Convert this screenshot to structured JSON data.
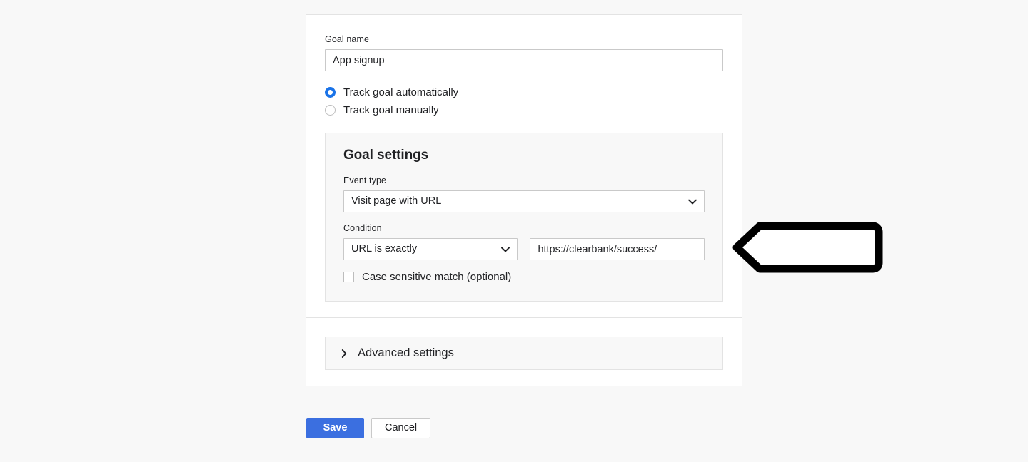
{
  "form": {
    "goal_name": {
      "label": "Goal name",
      "value": "App signup",
      "placeholder": "Goal name"
    },
    "tracking_mode": {
      "options": [
        {
          "label": "Track goal automatically",
          "selected": true
        },
        {
          "label": "Track goal manually",
          "selected": false
        }
      ]
    },
    "goal_settings": {
      "title": "Goal settings",
      "event_type": {
        "label": "Event type",
        "value": "Visit page with URL",
        "chevron_icon": "chevron-down-icon"
      },
      "condition": {
        "label": "Condition",
        "value": "URL is exactly",
        "chevron_icon": "chevron-down-icon",
        "url_value": "https://clearbank/success/",
        "url_placeholder": "https://example.com/"
      },
      "case_sensitive": {
        "label": "Case sensitive match (optional)",
        "checked": false
      }
    },
    "advanced": {
      "label": "Advanced settings",
      "chevron_icon": "chevron-right-icon",
      "expanded": false
    }
  },
  "footer": {
    "save_label": "Save",
    "cancel_label": "Cancel"
  },
  "annotation": {
    "arrow_icon": "left-arrow-annotation",
    "points_to": "url_value"
  },
  "colors": {
    "accent_blue": "#1a73e8",
    "save_blue": "#3b6fe0",
    "page_background": "#f8f8f8",
    "card_background": "#ffffff",
    "border_gray": "#e3e3e3",
    "input_border": "#c9c9c9",
    "annotation_black": "#000000"
  }
}
